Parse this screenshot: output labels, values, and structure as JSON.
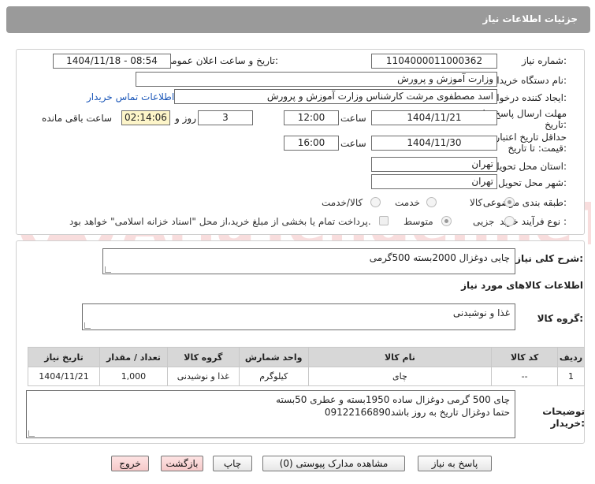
{
  "header": {
    "title": "جزئیات اطلاعات نیاز"
  },
  "form": {
    "need_number_label": "شماره نیاز:",
    "need_number": "1104000011000362",
    "announce_label": "تاریخ و ساعت اعلان عمومی:",
    "announce_value": "1404/11/18 - 08:54",
    "buyer_org_label": "نام دستگاه خریدار:",
    "buyer_org": "وزارت آموزش و پرورش",
    "creator_label": "ایجاد کننده درخواست:",
    "creator": "اسد مصطفوی مرشت کارشناس وزارت آموزش و پرورش",
    "contact_link": "اطلاعات تماس خریدار",
    "deadline_label_1": "مهلت ارسال پاسخ: تا",
    "deadline_label_2": "تاریخ:",
    "deadline_date": "1404/11/21",
    "time_label": "ساعت",
    "deadline_time": "12:00",
    "days_value": "3",
    "days_label": "روز و",
    "remaining_time": "02:14:06",
    "remaining_label": "ساعت باقی مانده",
    "validity_label_1": "حداقل تاریخ اعتبار",
    "validity_label_2": "قیمت: تا تاریخ:",
    "validity_date": "1404/11/30",
    "validity_time": "16:00",
    "province_label": "استان محل تحویل:",
    "province": "تهران",
    "city_label": "شهر محل تحویل:",
    "city": "تهران",
    "category_label": "طبقه بندی موضوعی:",
    "category_options": [
      "کالا",
      "خدمت",
      "کالا/خدمت"
    ],
    "category_selected": "کالا",
    "process_label": "نوع فرآیند خرید :",
    "process_options": [
      "جزیی",
      "متوسط"
    ],
    "process_selected": "جزیی",
    "payment_note": "پرداخت تمام یا بخشی از مبلغ خرید،از محل \"اسناد خزانه اسلامی\" خواهد بود."
  },
  "summary": {
    "label": "شرح کلی نیاز:",
    "value": "چایی دوغزال 2000بسته 500گرمی",
    "goods_info_title": "اطلاعات کالاهای مورد نیاز",
    "group_label": "گروه کالا:",
    "group_value": "غذا و نوشیدنی"
  },
  "table": {
    "headers": [
      "ردیف",
      "کد کالا",
      "نام کالا",
      "واحد شمارش",
      "گروه کالا",
      "تعداد / مقدار",
      "تاریخ نیاز"
    ],
    "rows": [
      [
        "1",
        "--",
        "چای",
        "کیلوگرم",
        "غذا و نوشیدنی",
        "1,000",
        "1404/11/21"
      ]
    ]
  },
  "notes": {
    "label_1": "توضیحات",
    "label_2": "خریدار:",
    "line1": "چای 500 گرمی دوغزال ساده  1950بسته و عطری 50بسته",
    "line2": "حتما دوغزال تاریخ به روز باشد09122166890"
  },
  "buttons": {
    "reply": "پاسخ به نیاز",
    "attachments": "مشاهده مدارک پیوستی (0)",
    "print": "چاپ",
    "back": "بازگشت",
    "exit": "خروج"
  },
  "watermark_text": "AriaTender.neT",
  "colors": {
    "header_bg": "#9a9a9a",
    "link": "#1a56b8",
    "remaining_bg": "#fdf5c9",
    "exit_bg": "#f6c9c9"
  }
}
